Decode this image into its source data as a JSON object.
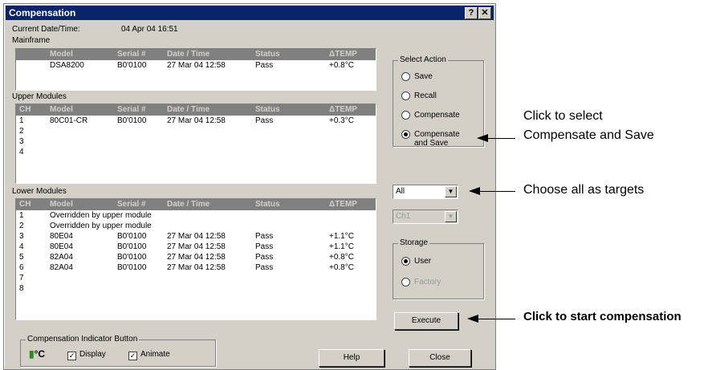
{
  "dialog": {
    "title": "Compensation",
    "help_btn": "?",
    "close_btn": "✕",
    "current_label": "Current Date/Time:",
    "current_value": "04 Apr 04 16:51",
    "mainframe_label": "Mainframe",
    "upper_label": "Upper Modules",
    "lower_label": "Lower Modules"
  },
  "mainframe": {
    "headers": [
      "",
      "Model",
      "Serial #",
      "Date / Time",
      "Status",
      "ΔTEMP"
    ],
    "rows": [
      [
        "",
        "DSA8200",
        "B0'0100",
        "27 Mar 04 12:58",
        "Pass",
        "+0.8°C"
      ]
    ]
  },
  "upper": {
    "headers": [
      "CH",
      "Model",
      "Serial #",
      "Date / Time",
      "Status",
      "ΔTEMP"
    ],
    "rows": [
      [
        "1",
        "80C01-CR",
        "B0'0100",
        "27 Mar 04 12:58",
        "Pass",
        "+0.3°C"
      ],
      [
        "2",
        "",
        "",
        "",
        "",
        ""
      ],
      [
        "3",
        "",
        "",
        "",
        "",
        ""
      ],
      [
        "4",
        "",
        "",
        "",
        "",
        ""
      ]
    ]
  },
  "lower": {
    "headers": [
      "CH",
      "Model",
      "Serial #",
      "Date / Time",
      "Status",
      "ΔTEMP"
    ],
    "rows": [
      [
        "1",
        "Overridden by upper module",
        "",
        "",
        "",
        ""
      ],
      [
        "2",
        "Overridden by upper module",
        "",
        "",
        "",
        ""
      ],
      [
        "3",
        "80E04",
        "B0'0100",
        "27 Mar 04 12:58",
        "Pass",
        "+1.1°C"
      ],
      [
        "4",
        "80E04",
        "B0'0100",
        "27 Mar 04 12:58",
        "Pass",
        "+1.1°C"
      ],
      [
        "5",
        "82A04",
        "B0'0100",
        "27 Mar 04 12:58",
        "Pass",
        "+0.8°C"
      ],
      [
        "6",
        "82A04",
        "B0'0100",
        "27 Mar 04 12:58",
        "Pass",
        "+0.8°C"
      ],
      [
        "7",
        "",
        "",
        "",
        "",
        ""
      ],
      [
        "8",
        "",
        "",
        "",
        "",
        ""
      ]
    ]
  },
  "select_action": {
    "title": "Select Action",
    "options": [
      "Save",
      "Recall",
      "Compensate",
      "Compensate and Save"
    ],
    "selected": "Compensate and Save"
  },
  "target": {
    "value": "All",
    "channel_value": "Ch1"
  },
  "storage": {
    "title": "Storage",
    "options": [
      "User",
      "Factory"
    ],
    "selected": "User"
  },
  "buttons": {
    "execute": "Execute",
    "help": "Help",
    "close": "Close"
  },
  "indicator": {
    "title": "Compensation Indicator Button",
    "icon_text": "°C",
    "display_label": "Display",
    "animate_label": "Animate",
    "display_checked": true,
    "animate_checked": true
  },
  "callouts": {
    "select_line1": "Click to select",
    "select_line2": "Compensate and Save",
    "targets": "Choose all as targets",
    "execute": "Click to start compensation"
  }
}
